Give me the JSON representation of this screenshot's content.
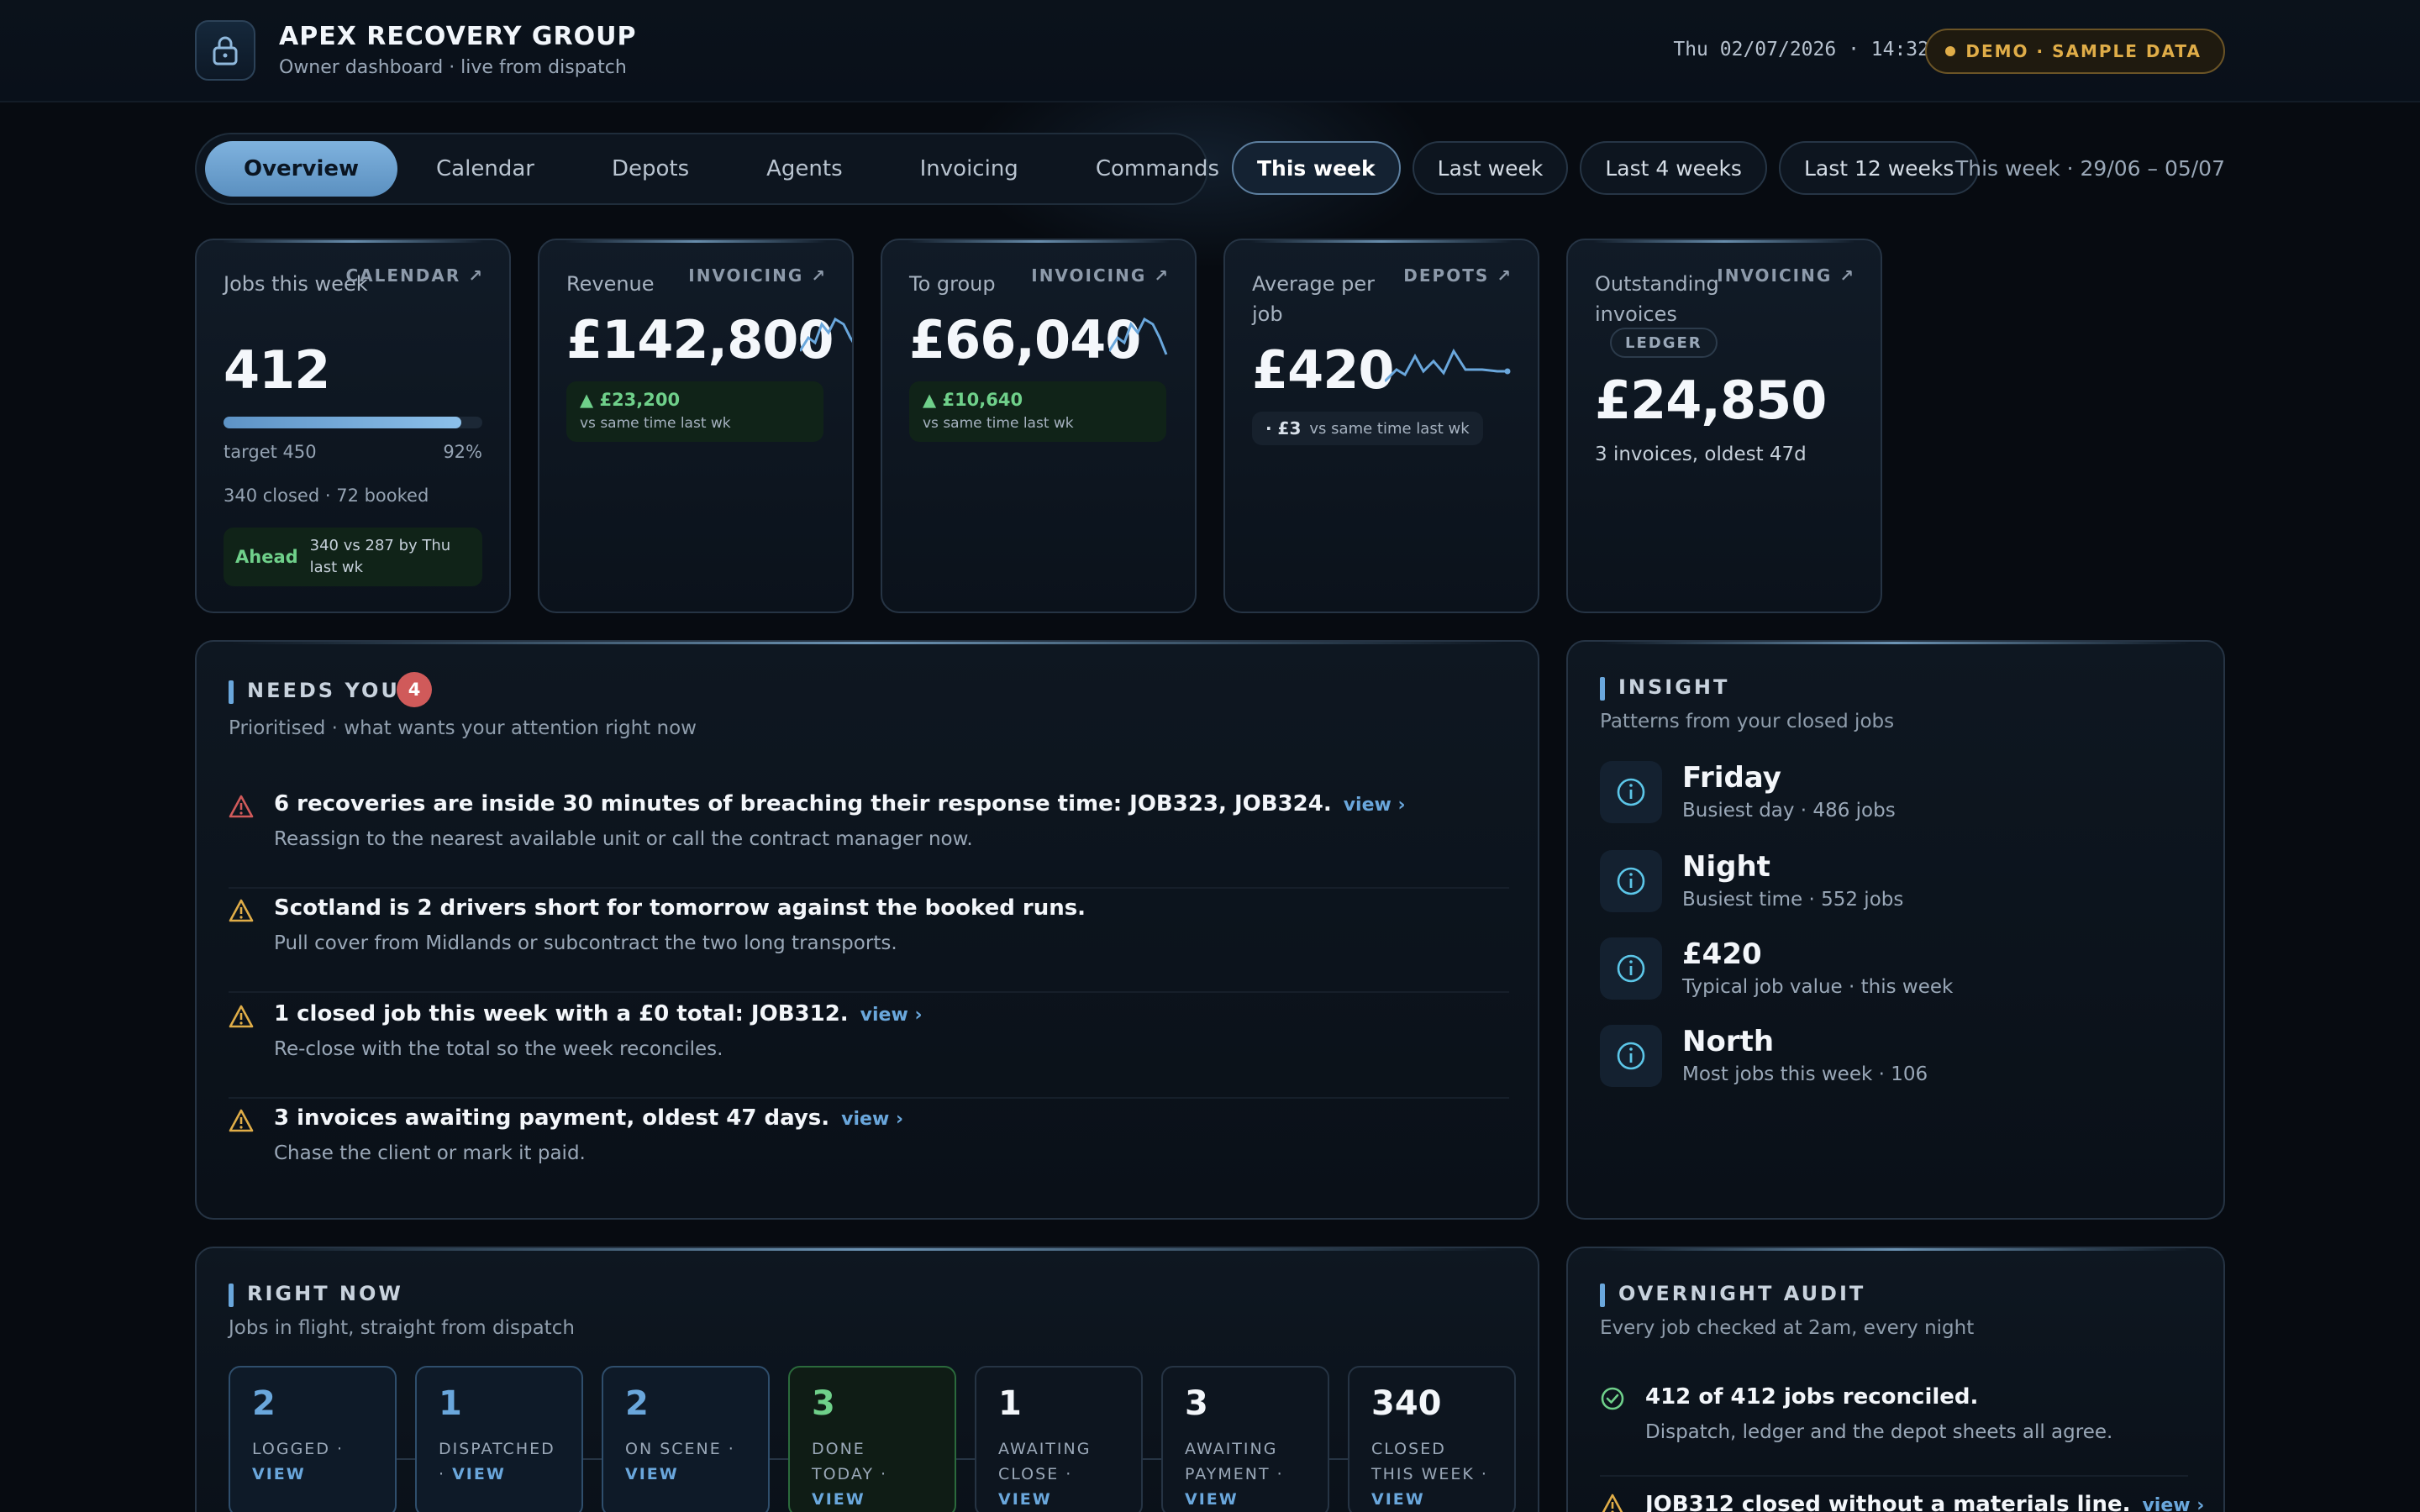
{
  "header": {
    "brand_title": "APEX RECOVERY GROUP",
    "brand_subtitle": "Owner dashboard · live from dispatch",
    "datetime": "Thu 02/07/2026 · 14:32",
    "demo_badge": "DEMO · SAMPLE DATA",
    "logo_icon": "lock-icon"
  },
  "nav": {
    "tabs": [
      {
        "label": "Overview",
        "active": true
      },
      {
        "label": "Calendar",
        "active": false
      },
      {
        "label": "Depots",
        "active": false
      },
      {
        "label": "Agents",
        "active": false
      },
      {
        "label": "Invoicing",
        "active": false
      },
      {
        "label": "Commands",
        "active": false
      }
    ],
    "periods": [
      {
        "label": "This week",
        "active": true
      },
      {
        "label": "Last week",
        "active": false
      },
      {
        "label": "Last 4 weeks",
        "active": false
      },
      {
        "label": "Last 12 weeks",
        "active": false
      }
    ],
    "period_range": "This week · 29/06 – 05/07"
  },
  "kpis": {
    "jobs": {
      "label": "Jobs this week",
      "link": "CALENDAR ↗",
      "value": "412",
      "progress_fraction": 0.92,
      "target": "target 450",
      "percent": "92%",
      "breakdown": "340 closed · 72 booked",
      "ahead_tag": "Ahead",
      "ahead_text": "340 vs 287 by Thu last wk"
    },
    "revenue": {
      "label": "Revenue",
      "link": "INVOICING ↗",
      "value": "£142,800",
      "delta": "▲ £23,200",
      "delta_sub": "vs same time last wk"
    },
    "to_group": {
      "label": "To group",
      "link": "INVOICING ↗",
      "value": "£66,040",
      "delta": "▲ £10,640",
      "delta_sub": "vs same time last wk"
    },
    "average": {
      "label": "Average per job",
      "link": "DEPOTS ↗",
      "value": "£420",
      "delta": "· £3",
      "delta_sub": "vs same time last wk"
    },
    "outstanding": {
      "label": "Outstanding invoices",
      "link": "INVOICING ↗",
      "badge": "LEDGER",
      "value": "£24,850",
      "sub": "3 invoices, oldest 47d"
    }
  },
  "needs_you": {
    "title": "NEEDS YOU",
    "count": "4",
    "subtitle": "Prioritised · what wants your attention right now",
    "items": [
      {
        "severity": "critical",
        "icon": "alert-triangle-icon",
        "title": "6 recoveries are inside 30 minutes of breaching their response time: JOB323, JOB324.",
        "link": "view ›",
        "detail": "Reassign to the nearest available unit or call the contract manager now."
      },
      {
        "severity": "warning",
        "icon": "alert-triangle-icon",
        "title": "Scotland is 2 drivers short for tomorrow against the booked runs.",
        "link": "",
        "detail": "Pull cover from Midlands or subcontract the two long transports."
      },
      {
        "severity": "warning",
        "icon": "alert-triangle-icon",
        "title": "1 closed job this week with a £0 total: JOB312.",
        "link": "view ›",
        "detail": "Re-close with the total so the week reconciles."
      },
      {
        "severity": "warning",
        "icon": "alert-triangle-icon",
        "title": "3 invoices awaiting payment, oldest 47 days.",
        "link": "view ›",
        "detail": "Chase the client or mark it paid."
      }
    ]
  },
  "insight": {
    "title": "INSIGHT",
    "subtitle": "Patterns from your closed jobs",
    "items": [
      {
        "icon": "info-icon",
        "title": "Friday",
        "sub": "Busiest day · 486 jobs"
      },
      {
        "icon": "info-icon",
        "title": "Night",
        "sub": "Busiest time · 552 jobs"
      },
      {
        "icon": "info-icon",
        "title": "£420",
        "sub": "Typical job value · this week"
      },
      {
        "icon": "info-icon",
        "title": "North",
        "sub": "Most jobs this week · 106"
      }
    ]
  },
  "right_now": {
    "title": "RIGHT NOW",
    "subtitle": "Jobs in flight, straight from dispatch",
    "stats": [
      {
        "num": "2",
        "label": "LOGGED ·",
        "view": "VIEW",
        "tone": "blue"
      },
      {
        "num": "1",
        "label": "DISPATCHED ·",
        "view": "VIEW",
        "tone": "blue"
      },
      {
        "num": "2",
        "label": "ON SCENE ·",
        "view": "VIEW",
        "tone": "blue"
      },
      {
        "num": "3",
        "label": "DONE TODAY ·",
        "view": "VIEW",
        "tone": "green"
      },
      {
        "num": "1",
        "label": "AWAITING CLOSE ·",
        "view": "VIEW",
        "tone": "plain"
      },
      {
        "num": "3",
        "label": "AWAITING PAYMENT ·",
        "view": "VIEW",
        "tone": "plain"
      },
      {
        "num": "340",
        "label": "CLOSED THIS WEEK ·",
        "view": "VIEW",
        "tone": "plain"
      }
    ]
  },
  "audit": {
    "title": "OVERNIGHT AUDIT",
    "subtitle": "Every job checked at 2am, every night",
    "items": [
      {
        "icon": "check-circle-icon",
        "title": "412 of 412 jobs reconciled.",
        "detail": "Dispatch, ledger and the depot sheets all agree.",
        "link": ""
      },
      {
        "icon": "alert-triangle-icon",
        "title": "JOB312 closed without a materials line.",
        "detail": "",
        "link": "view ›"
      }
    ]
  },
  "colors": {
    "accent": "#6aa7dc",
    "positive": "#6fd08a",
    "warning": "#e0ad48",
    "critical": "#d05a5a"
  }
}
